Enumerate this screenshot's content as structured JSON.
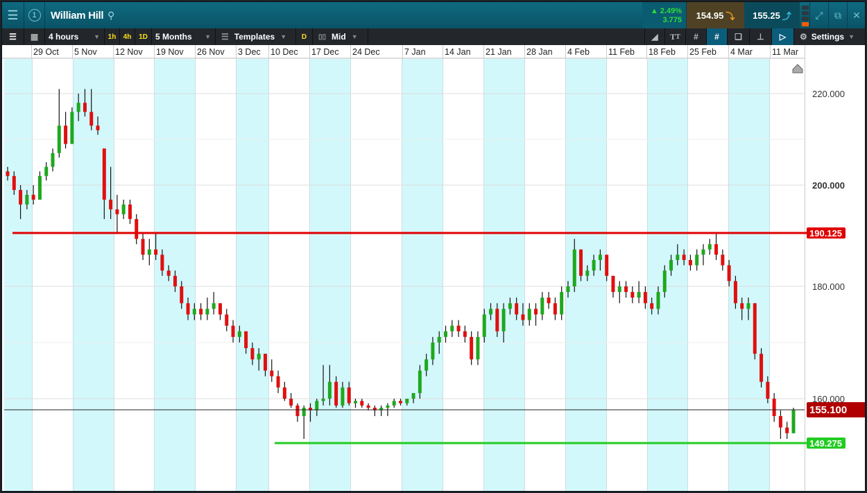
{
  "title_bar": {
    "menu_icon": "hamburger-icon",
    "link_number": "1",
    "instrument": "William Hill",
    "change_percent": "2.49%",
    "change_value": "3.775",
    "sell_price": "154.95",
    "buy_price": "155.25"
  },
  "toolbar": {
    "interval": "4 hours",
    "quick_1h": "1h",
    "quick_4h": "4h",
    "quick_1d": "1D",
    "range": "5 Months",
    "templates": "Templates",
    "d_badge": "D",
    "price_type": "Mid",
    "settings": "Settings"
  },
  "date_axis": [
    "29 Oct",
    "5 Nov",
    "12 Nov",
    "19 Nov",
    "26 Nov",
    "3 Dec",
    "10 Dec",
    "17 Dec",
    "24 Dec",
    "7 Jan",
    "14 Jan",
    "21 Jan",
    "28 Jan",
    "4 Feb",
    "11 Feb",
    "18 Feb",
    "25 Feb",
    "4 Mar",
    "11 Mar"
  ],
  "price_axis": [
    "220.000",
    "200.000",
    "180.000",
    "160.000"
  ],
  "colors": {
    "up": "#1fa81f",
    "down": "#e01010",
    "resistance": "#e00000",
    "support": "#22cc22",
    "current": "#b00000",
    "band": "#d3f8fb"
  },
  "chart_data": {
    "type": "candlestick",
    "instrument": "William Hill",
    "interval": "4 hours",
    "y_ticks": [
      220,
      200,
      180,
      160
    ],
    "scale": "log",
    "lines": [
      {
        "name": "resistance",
        "value": 190.125,
        "label": "190.125"
      },
      {
        "name": "support",
        "value": 149.275,
        "label": "149.275"
      },
      {
        "name": "current",
        "value": 155.1,
        "label": "155.100"
      }
    ],
    "ohlc": [
      [
        203,
        204,
        201,
        202
      ],
      [
        202,
        203,
        198,
        199
      ],
      [
        199,
        200,
        193,
        196
      ],
      [
        196,
        199,
        195,
        198
      ],
      [
        198,
        200,
        196,
        197
      ],
      [
        197,
        203,
        197,
        202
      ],
      [
        202,
        205,
        201,
        204
      ],
      [
        204,
        208,
        203,
        207
      ],
      [
        207,
        221,
        206,
        213
      ],
      [
        213,
        216,
        208,
        209
      ],
      [
        209,
        217,
        209,
        216
      ],
      [
        216,
        220,
        214,
        218
      ],
      [
        218,
        221,
        215,
        216
      ],
      [
        216,
        221,
        212,
        213
      ],
      [
        213,
        215,
        211,
        212
      ],
      [
        208,
        208,
        193,
        197
      ],
      [
        197,
        204,
        193,
        195
      ],
      [
        195,
        198,
        190,
        194
      ],
      [
        194,
        197,
        193,
        196
      ],
      [
        196,
        197,
        192,
        193
      ],
      [
        193,
        194,
        188,
        189
      ],
      [
        189,
        190,
        185,
        186
      ],
      [
        186,
        189,
        184,
        187
      ],
      [
        187,
        190,
        185,
        186
      ],
      [
        186,
        187,
        182,
        183
      ],
      [
        183,
        184,
        181,
        182
      ],
      [
        182,
        183,
        179,
        180
      ],
      [
        180,
        181,
        176,
        177
      ],
      [
        177,
        178,
        174,
        175
      ],
      [
        175,
        177,
        174,
        176
      ],
      [
        176,
        177,
        174,
        175
      ],
      [
        175,
        178,
        174,
        176
      ],
      [
        176,
        179,
        175,
        177
      ],
      [
        177,
        177,
        174,
        175
      ],
      [
        175,
        176,
        172,
        173
      ],
      [
        173,
        174,
        170,
        171
      ],
      [
        171,
        173,
        170,
        172
      ],
      [
        172,
        172,
        168,
        169
      ],
      [
        169,
        170,
        166,
        167
      ],
      [
        167,
        169,
        165,
        168
      ],
      [
        168,
        168,
        164,
        165
      ],
      [
        165,
        167,
        163,
        164
      ],
      [
        164,
        165,
        161,
        162
      ],
      [
        162,
        163,
        159,
        160
      ],
      [
        160,
        161,
        156,
        157
      ],
      [
        157,
        158,
        153,
        154
      ],
      [
        154,
        157,
        150,
        156
      ],
      [
        156,
        158,
        153,
        155
      ],
      [
        155,
        160,
        154,
        159
      ],
      [
        159,
        166,
        157,
        160
      ],
      [
        160,
        166,
        157,
        163
      ],
      [
        163,
        164,
        156,
        157
      ],
      [
        157,
        163,
        156,
        162
      ],
      [
        162,
        163,
        157,
        158
      ],
      [
        158,
        160,
        156,
        159
      ],
      [
        159,
        160,
        156,
        157
      ],
      [
        157,
        158,
        155,
        156
      ],
      [
        156,
        157,
        154,
        155
      ],
      [
        155,
        157,
        154,
        156
      ],
      [
        156,
        158,
        154,
        157
      ],
      [
        157,
        160,
        156,
        159
      ],
      [
        159,
        160,
        157,
        158
      ],
      [
        158,
        160,
        157,
        160
      ],
      [
        160,
        161,
        158,
        161
      ],
      [
        161,
        166,
        160,
        165
      ],
      [
        165,
        168,
        164,
        167
      ],
      [
        167,
        171,
        166,
        170
      ],
      [
        170,
        172,
        168,
        171
      ],
      [
        171,
        173,
        170,
        172
      ],
      [
        172,
        174,
        171,
        173
      ],
      [
        173,
        174,
        171,
        172
      ],
      [
        172,
        173,
        170,
        171
      ],
      [
        171,
        172,
        166,
        167
      ],
      [
        167,
        172,
        166,
        171
      ],
      [
        171,
        176,
        170,
        175
      ],
      [
        175,
        177,
        174,
        176
      ],
      [
        176,
        177,
        171,
        172
      ],
      [
        172,
        177,
        170,
        176
      ],
      [
        176,
        178,
        175,
        177
      ],
      [
        177,
        178,
        174,
        175
      ],
      [
        175,
        177,
        173,
        174
      ],
      [
        174,
        177,
        173,
        176
      ],
      [
        176,
        177,
        173,
        175
      ],
      [
        175,
        179,
        174,
        178
      ],
      [
        178,
        179,
        176,
        177
      ],
      [
        177,
        178,
        174,
        175
      ],
      [
        175,
        180,
        174,
        179
      ],
      [
        179,
        181,
        178,
        180
      ],
      [
        180,
        189,
        179,
        187
      ],
      [
        187,
        187,
        181,
        182
      ],
      [
        182,
        184,
        181,
        183
      ],
      [
        183,
        186,
        182,
        185
      ],
      [
        185,
        187,
        183,
        186
      ],
      [
        186,
        186,
        181,
        182
      ],
      [
        182,
        182,
        178,
        179
      ],
      [
        179,
        181,
        177,
        180
      ],
      [
        180,
        181,
        178,
        179
      ],
      [
        179,
        180,
        177,
        178
      ],
      [
        178,
        181,
        177,
        179
      ],
      [
        179,
        180,
        176,
        177
      ],
      [
        177,
        178,
        175,
        176
      ],
      [
        176,
        180,
        175,
        179
      ],
      [
        179,
        184,
        178,
        183
      ],
      [
        183,
        186,
        182,
        185
      ],
      [
        185,
        188,
        184,
        186
      ],
      [
        186,
        187,
        184,
        185
      ],
      [
        185,
        186,
        183,
        184
      ],
      [
        184,
        187,
        183,
        186
      ],
      [
        186,
        188,
        184,
        187
      ],
      [
        187,
        189,
        186,
        188
      ],
      [
        188,
        190,
        185,
        186
      ],
      [
        186,
        187,
        183,
        184
      ],
      [
        184,
        185,
        180,
        181
      ],
      [
        181,
        182,
        176,
        177
      ],
      [
        177,
        178,
        174,
        176
      ],
      [
        176,
        178,
        174,
        177
      ],
      [
        177,
        177,
        167,
        168
      ],
      [
        168,
        169,
        162,
        163
      ],
      [
        163,
        164,
        158,
        160
      ],
      [
        160,
        161,
        153,
        154
      ],
      [
        154,
        155,
        150,
        152
      ],
      [
        152,
        153,
        150,
        151
      ],
      [
        151,
        156,
        151,
        155.1
      ]
    ]
  }
}
